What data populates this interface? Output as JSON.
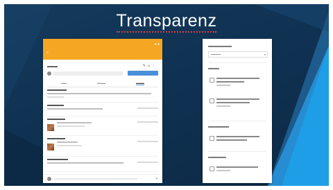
{
  "slide": {
    "title": "Transparenz",
    "background": "#123659",
    "accent": "#2ba3e6"
  },
  "left_panel": {
    "topbar_color": "#f5a623",
    "post_button_color": "#4a90d9",
    "icons": [
      "edit-icon",
      "people-icon",
      "more-icon"
    ]
  },
  "right_panel": {
    "section_count": 4
  }
}
